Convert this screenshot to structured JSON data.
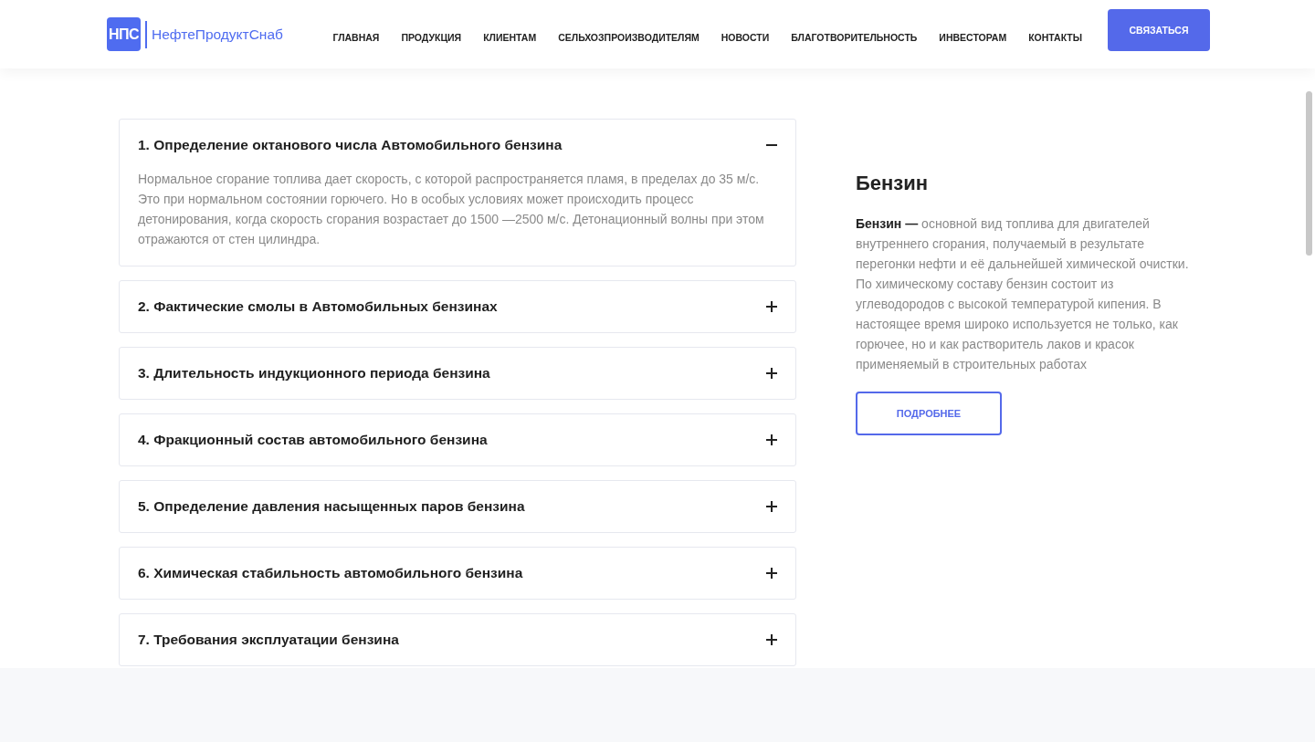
{
  "header": {
    "logo": {
      "mark": "НПС",
      "name": "НефтеПродуктСнаб"
    },
    "nav": [
      {
        "label": "ГЛАВНАЯ"
      },
      {
        "label": "ПРОДУКЦИЯ"
      },
      {
        "label": "КЛИЕНТАМ"
      },
      {
        "label": "СЕЛЬХОЗПРОИЗВОДИТЕЛЯМ"
      },
      {
        "label": "НОВОСТИ"
      },
      {
        "label": "БЛАГОТВОРИТЕЛЬНОСТЬ"
      },
      {
        "label": "ИНВЕСТОРАМ"
      },
      {
        "label": "КОНТАКТЫ"
      }
    ],
    "cta": "СВЯЗАТЬСЯ"
  },
  "accordion": [
    {
      "title": "1. Определение октанового числа Автомобильного бензина",
      "expanded": true,
      "body": "Нормальное сгорание топлива дает скорость, с которой распространяется пламя, в пределах до 35 м/с. Это при нормальном состоянии горючего. Но в особых условиях может происходить процесс детонирования, когда скорость сгорания возрастает до 1500 —2500 м/с. Детонационный волны при этом отражаются от стен цилиндра."
    },
    {
      "title": "2. Фактические смолы в Автомобильных бензинах",
      "expanded": false
    },
    {
      "title": "3. Длительность индукционного периода бензина",
      "expanded": false
    },
    {
      "title": "4. Фракционный состав автомобильного бензина",
      "expanded": false
    },
    {
      "title": "5. Определение давления насыщенных паров бензина",
      "expanded": false
    },
    {
      "title": "6. Химическая стабильность автомобильного бензина",
      "expanded": false
    },
    {
      "title": "7. Требования эксплуатации бензина",
      "expanded": false
    }
  ],
  "sidebar": {
    "title": "Бензин",
    "text": "**Бензин —** основной вид топлива для двигателей внутреннего сгорания, получаемый в результате перегонки нефти и её дальнейшей химической очистки. По химическому составу бензин состоит из углеводородов с высокой температурой кипения. В настоящее время широко используется не только, как горючее, но и как растворитель лаков и красок применяемый в строительных работах",
    "button": "ПОДРОБНЕЕ"
  }
}
